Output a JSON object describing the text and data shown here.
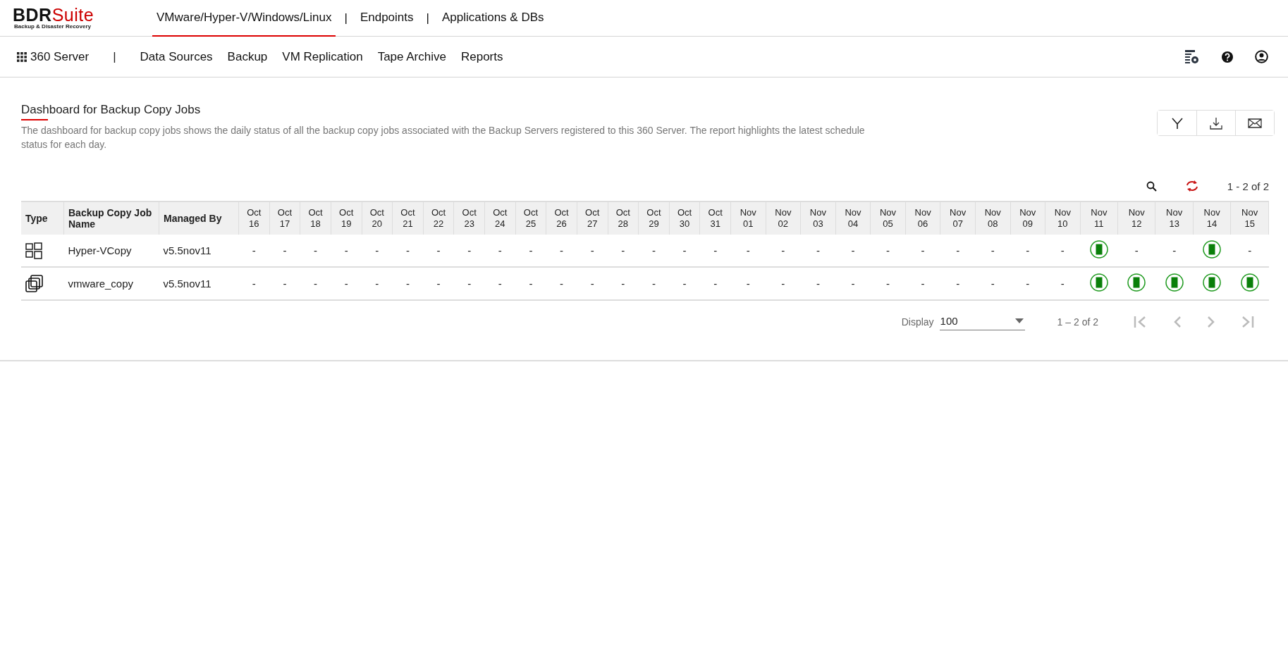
{
  "logo": {
    "name_dark": "BDR",
    "name_red": "Suite",
    "tagline": "Backup & Disaster Recovery"
  },
  "top_tabs": [
    {
      "label": "VMware/Hyper-V/Windows/Linux",
      "selected": true
    },
    {
      "label": "Endpoints",
      "selected": false
    },
    {
      "label": "Applications & DBs",
      "selected": false
    }
  ],
  "top_separator": "|",
  "server": "360 Server",
  "nav_separator": "|",
  "nav_items": [
    "Data Sources",
    "Backup",
    "VM Replication",
    "Tape Archive",
    "Reports"
  ],
  "page": {
    "title": "Dashboard for Backup Copy Jobs",
    "description": "The dashboard for backup copy jobs shows the daily status of all the backup copy jobs associated with the Backup Servers registered to this 360 Server. The report highlights the latest schedule status for each day."
  },
  "record_count": "1 - 2 of 2",
  "table": {
    "columns": [
      "Type",
      "Backup Copy Job Name",
      "Managed By"
    ],
    "dates": [
      [
        "Oct",
        "16"
      ],
      [
        "Oct",
        "17"
      ],
      [
        "Oct",
        "18"
      ],
      [
        "Oct",
        "19"
      ],
      [
        "Oct",
        "20"
      ],
      [
        "Oct",
        "21"
      ],
      [
        "Oct",
        "22"
      ],
      [
        "Oct",
        "23"
      ],
      [
        "Oct",
        "24"
      ],
      [
        "Oct",
        "25"
      ],
      [
        "Oct",
        "26"
      ],
      [
        "Oct",
        "27"
      ],
      [
        "Oct",
        "28"
      ],
      [
        "Oct",
        "29"
      ],
      [
        "Oct",
        "30"
      ],
      [
        "Oct",
        "31"
      ],
      [
        "Nov",
        "01"
      ],
      [
        "Nov",
        "02"
      ],
      [
        "Nov",
        "03"
      ],
      [
        "Nov",
        "04"
      ],
      [
        "Nov",
        "05"
      ],
      [
        "Nov",
        "06"
      ],
      [
        "Nov",
        "07"
      ],
      [
        "Nov",
        "08"
      ],
      [
        "Nov",
        "09"
      ],
      [
        "Nov",
        "10"
      ],
      [
        "Nov",
        "11"
      ],
      [
        "Nov",
        "12"
      ],
      [
        "Nov",
        "13"
      ],
      [
        "Nov",
        "14"
      ],
      [
        "Nov",
        "15"
      ]
    ],
    "rows": [
      {
        "kind": "hyperv",
        "name": "Hyper-VCopy",
        "managed_by": "v5.5nov11",
        "cells": [
          {
            "kind": "empty",
            "text": "-"
          },
          {
            "kind": "empty",
            "text": "-"
          },
          {
            "kind": "empty",
            "text": "-"
          },
          {
            "kind": "empty",
            "text": "-"
          },
          {
            "kind": "empty",
            "text": "-"
          },
          {
            "kind": "empty",
            "text": "-"
          },
          {
            "kind": "empty",
            "text": "-"
          },
          {
            "kind": "empty",
            "text": "-"
          },
          {
            "kind": "empty",
            "text": "-"
          },
          {
            "kind": "empty",
            "text": "-"
          },
          {
            "kind": "empty",
            "text": "-"
          },
          {
            "kind": "empty",
            "text": "-"
          },
          {
            "kind": "empty",
            "text": "-"
          },
          {
            "kind": "empty",
            "text": "-"
          },
          {
            "kind": "empty",
            "text": "-"
          },
          {
            "kind": "empty",
            "text": "-"
          },
          {
            "kind": "empty",
            "text": "-"
          },
          {
            "kind": "empty",
            "text": "-"
          },
          {
            "kind": "empty",
            "text": "-"
          },
          {
            "kind": "empty",
            "text": "-"
          },
          {
            "kind": "empty",
            "text": "-"
          },
          {
            "kind": "empty",
            "text": "-"
          },
          {
            "kind": "empty",
            "text": "-"
          },
          {
            "kind": "empty",
            "text": "-"
          },
          {
            "kind": "empty",
            "text": "-"
          },
          {
            "kind": "empty",
            "text": "-"
          },
          {
            "kind": "success"
          },
          {
            "kind": "empty",
            "text": "-"
          },
          {
            "kind": "empty",
            "text": "-"
          },
          {
            "kind": "success"
          },
          {
            "kind": "empty",
            "text": "-"
          }
        ]
      },
      {
        "kind": "vmware",
        "name": "vmware_copy",
        "managed_by": "v5.5nov11",
        "cells": [
          {
            "kind": "empty",
            "text": "-"
          },
          {
            "kind": "empty",
            "text": "-"
          },
          {
            "kind": "empty",
            "text": "-"
          },
          {
            "kind": "empty",
            "text": "-"
          },
          {
            "kind": "empty",
            "text": "-"
          },
          {
            "kind": "empty",
            "text": "-"
          },
          {
            "kind": "empty",
            "text": "-"
          },
          {
            "kind": "empty",
            "text": "-"
          },
          {
            "kind": "empty",
            "text": "-"
          },
          {
            "kind": "empty",
            "text": "-"
          },
          {
            "kind": "empty",
            "text": "-"
          },
          {
            "kind": "empty",
            "text": "-"
          },
          {
            "kind": "empty",
            "text": "-"
          },
          {
            "kind": "empty",
            "text": "-"
          },
          {
            "kind": "empty",
            "text": "-"
          },
          {
            "kind": "empty",
            "text": "-"
          },
          {
            "kind": "empty",
            "text": "-"
          },
          {
            "kind": "empty",
            "text": "-"
          },
          {
            "kind": "empty",
            "text": "-"
          },
          {
            "kind": "empty",
            "text": "-"
          },
          {
            "kind": "empty",
            "text": "-"
          },
          {
            "kind": "empty",
            "text": "-"
          },
          {
            "kind": "empty",
            "text": "-"
          },
          {
            "kind": "empty",
            "text": "-"
          },
          {
            "kind": "empty",
            "text": "-"
          },
          {
            "kind": "empty",
            "text": "-"
          },
          {
            "kind": "success"
          },
          {
            "kind": "success"
          },
          {
            "kind": "success"
          },
          {
            "kind": "success"
          },
          {
            "kind": "success"
          }
        ]
      }
    ]
  },
  "pagination": {
    "display_label": "Display",
    "page_size": "100",
    "range": "1 – 2 of 2"
  }
}
